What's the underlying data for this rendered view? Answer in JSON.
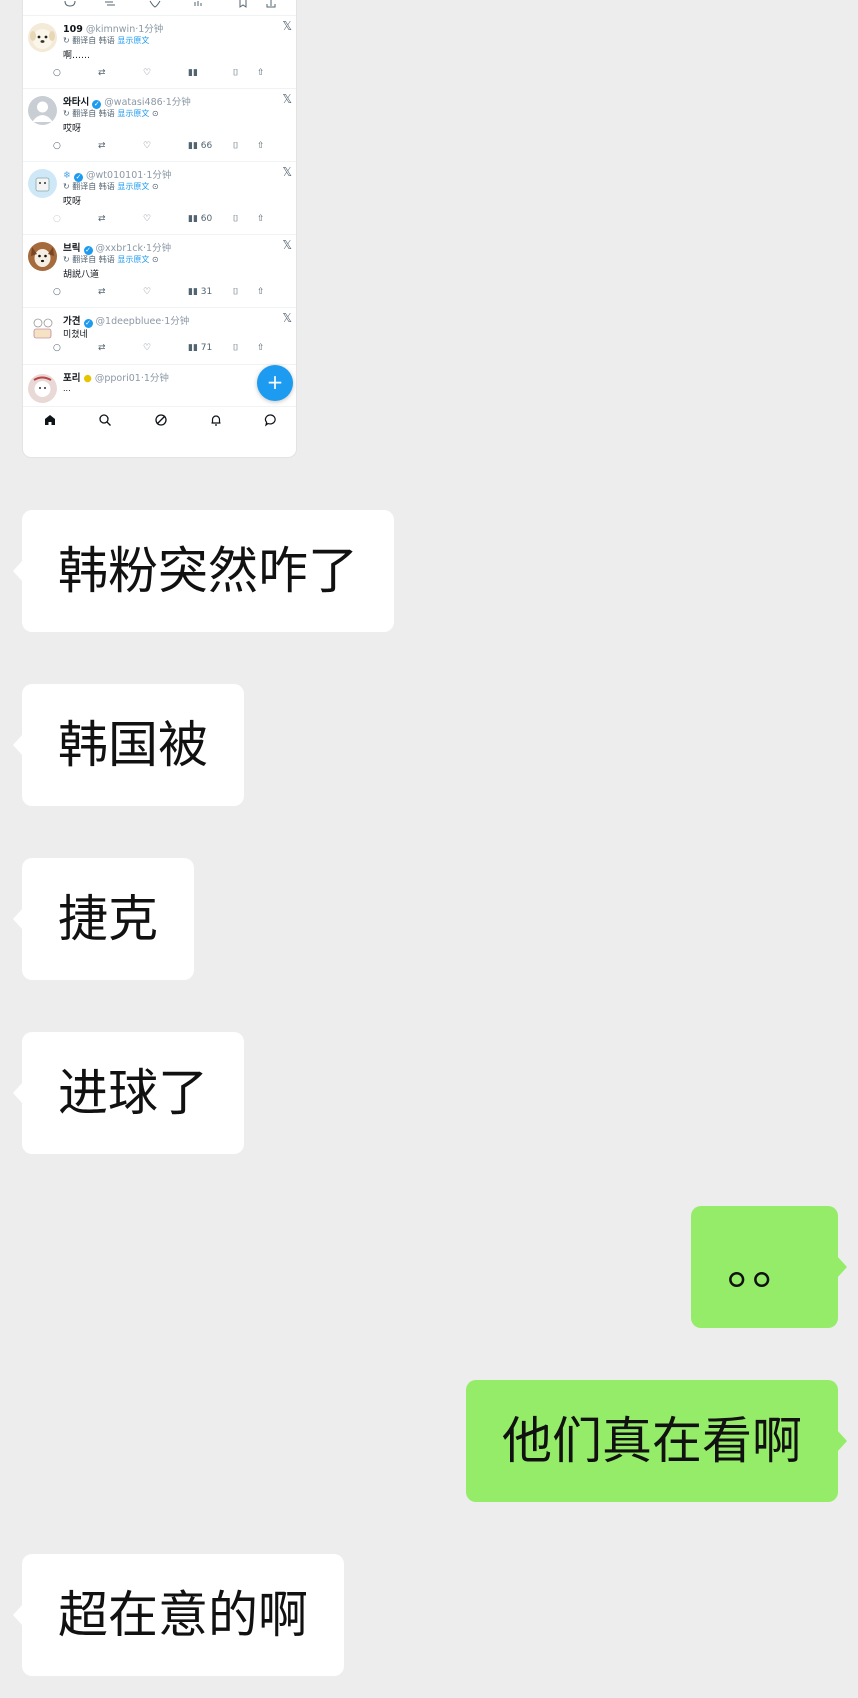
{
  "screenshot": {
    "tweets": [
      {
        "name": "109",
        "verified": false,
        "handle": "@kimnwin",
        "time": "1分钟",
        "translated": "翻译自 韩语",
        "show_original": "显示原文",
        "body": "啊……",
        "views": ""
      },
      {
        "name": "와타시",
        "verified": true,
        "handle": "@watasi486",
        "time": "1分钟",
        "translated": "翻译自 韩语",
        "show_original": "显示原文",
        "body": "哎呀",
        "views": "66"
      },
      {
        "name": "",
        "verified": true,
        "handle": "@wt010101",
        "time": "1分钟",
        "translated": "翻译自 韩语",
        "show_original": "显示原文",
        "body": "哎呀",
        "views": "60"
      },
      {
        "name": "브릭",
        "verified": true,
        "handle": "@xxbr1ck",
        "time": "1分钟",
        "translated": "翻译自 韩语",
        "show_original": "显示原文",
        "body": "胡説八道",
        "views": "31"
      },
      {
        "name": "가견",
        "verified": true,
        "handle": "@1deepbluee",
        "time": "1分钟",
        "translated": "",
        "show_original": "",
        "body": "미쳤네",
        "views": "71"
      },
      {
        "name": "포리",
        "verified": false,
        "handle": "@ppori01",
        "time": "1分钟",
        "translated": "",
        "show_original": "",
        "body": "...",
        "views": ""
      }
    ],
    "fab_label": "+",
    "colors": {
      "accent": "#1d9bf0"
    }
  },
  "messages": [
    {
      "side": "in",
      "text": "韩粉突然咋了"
    },
    {
      "side": "in",
      "text": "韩国被"
    },
    {
      "side": "in",
      "text": "捷克"
    },
    {
      "side": "in",
      "text": "进球了"
    },
    {
      "side": "out",
      "text": "。。"
    },
    {
      "side": "out",
      "text": "他们真在看啊"
    },
    {
      "side": "in",
      "text": "超在意的啊"
    }
  ],
  "colors": {
    "background": "#ededed",
    "incoming_bubble": "#ffffff",
    "outgoing_bubble": "#95ec69"
  }
}
